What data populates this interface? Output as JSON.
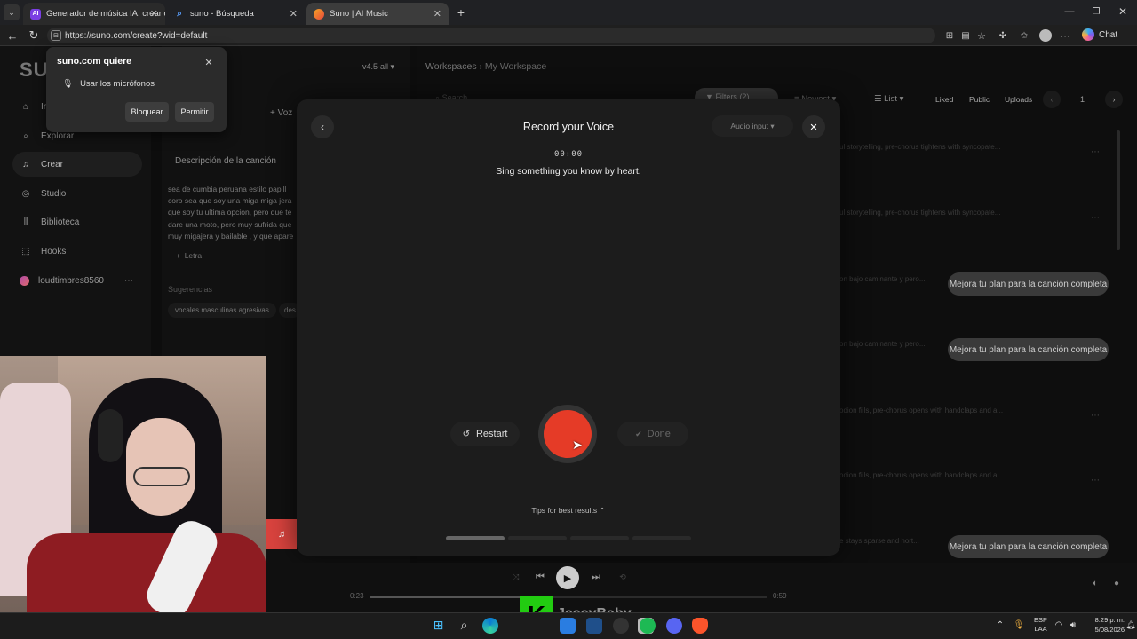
{
  "browser": {
    "tabs": [
      {
        "label": "Generador de música IA: crear can",
        "fav": "AI"
      },
      {
        "label": "suno - Búsqueda",
        "fav": ""
      },
      {
        "label": "Suno | AI Music",
        "fav": ""
      }
    ],
    "url": "https://suno.com/create?wid=default",
    "chat_label": "Chat"
  },
  "permission_popup": {
    "title": "suno.com quiere",
    "item": "Usar los micrófonos",
    "block_label": "Bloquear",
    "allow_label": "Permitir"
  },
  "sidebar": {
    "logo": "SU",
    "items": [
      {
        "label": "Inicio",
        "icon": "home-icon"
      },
      {
        "label": "Explorar",
        "icon": "search-icon"
      },
      {
        "label": "Crear",
        "icon": "create-icon"
      },
      {
        "label": "Studio",
        "icon": "studio-icon"
      },
      {
        "label": "Biblioteca",
        "icon": "library-icon"
      },
      {
        "label": "Hooks",
        "icon": "hooks-icon"
      }
    ],
    "user": "loudtimbres8560"
  },
  "create_form": {
    "model": "v4.5-all",
    "voice_label": "Voz",
    "description_label": "Descripción de la canción",
    "lyrics_lines": [
      "sea de cumbia peruana estilo papill",
      "coro sea que soy una miga miga jera",
      "que soy tu ultima opcion, pero que te",
      "dare una moto, pero muy sufrida que",
      "muy migajera y bailable , y que apare"
    ],
    "lyrics_button": "Letra",
    "suggestions_label": "Sugerencias",
    "suggestions": [
      "vocales masculinas agresivas",
      "des"
    ]
  },
  "workspace": {
    "breadcrumb_root": "Workspaces",
    "breadcrumb_current": "My Workspace",
    "search_placeholder": "Search",
    "filters_label": "Filters (2)",
    "sort_label": "Newest",
    "view_label": "List",
    "tabs": [
      "Liked",
      "Public",
      "Uploads"
    ],
    "page": "1",
    "row_snippets": [
      "ul storytelling, pre-chorus tightens with syncopate...",
      "ul storytelling, pre-chorus tightens with syncopate...",
      "on bajo caminante y pero...",
      "on bajo caminante y pero...",
      "odion fills, pre-chorus opens with handclaps and a...",
      "odion fills, pre-chorus opens with handclaps and a...",
      "e stays sparse and hort..."
    ],
    "upgrade_label": "Mejora tu plan para la canción completa"
  },
  "modal": {
    "title": "Record your Voice",
    "audio_input_label": "Audio input",
    "timer": "00:00",
    "instruction": "Sing something you know by heart.",
    "restart_label": "Restart",
    "done_label": "Done",
    "tips_label": "Tips for best results"
  },
  "player": {
    "elapsed": "0:23",
    "duration": "0:59",
    "progress": 0.39
  },
  "stream_overlay": {
    "name": "JessyBaby"
  },
  "taskbar": {
    "lang": "ESP",
    "region": "LAA",
    "time": "8:29 p. m.",
    "date": "5/08/2026"
  }
}
